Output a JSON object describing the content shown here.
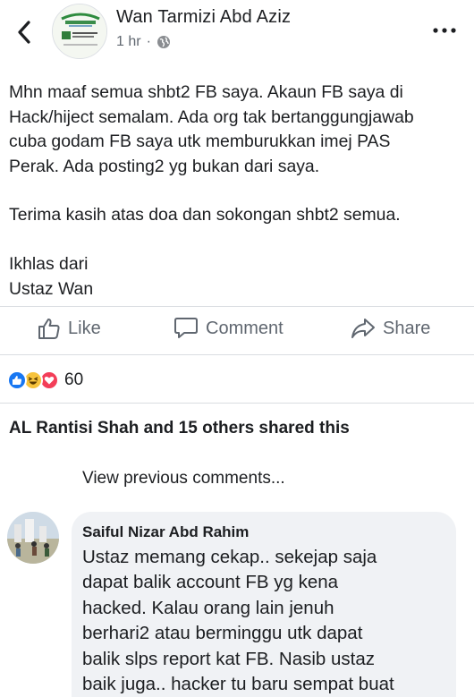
{
  "post": {
    "author": "Wan Tarmizi Abd Aziz",
    "time": "1 hr",
    "separator": "·",
    "privacy_icon": "globe-icon",
    "lines": [
      "Mhn maaf semua shbt2 FB saya. Akaun FB saya di",
      "Hack/hiject semalam. Ada org tak bertanggungjawab",
      "cuba godam FB saya utk memburukkan imej PAS",
      "Perak. Ada posting2 yg bukan dari saya."
    ],
    "thanks": "Terima kasih atas doa dan sokongan shbt2 semua.",
    "closing": [
      "Ikhlas dari",
      "Ustaz Wan"
    ]
  },
  "actions": {
    "like": "Like",
    "comment": "Comment",
    "share": "Share"
  },
  "reactions": {
    "icons": [
      "like-icon",
      "haha-icon",
      "love-icon"
    ],
    "count": "60"
  },
  "shares_text": "AL Rantisi Shah and 15 others shared this",
  "view_previous": "View previous comments...",
  "comment": {
    "author": "Saiful Nizar Abd Rahim",
    "lines": [
      "Ustaz memang cekap.. sekejap saja",
      "dapat balik account FB yg kena",
      "hacked. Kalau orang lain jenuh",
      "berhari2 atau berminggu utk dapat",
      "balik slps report kat FB. Nasib ustaz",
      "baik juga.. hacker tu baru sempat buat"
    ]
  },
  "colors": {
    "text": "#1c1e21",
    "muted": "#606770",
    "like_blue": "#1877f2",
    "haha_yellow": "#f7c33c",
    "love_red": "#f33e58",
    "bubble": "#f0f2f5"
  }
}
